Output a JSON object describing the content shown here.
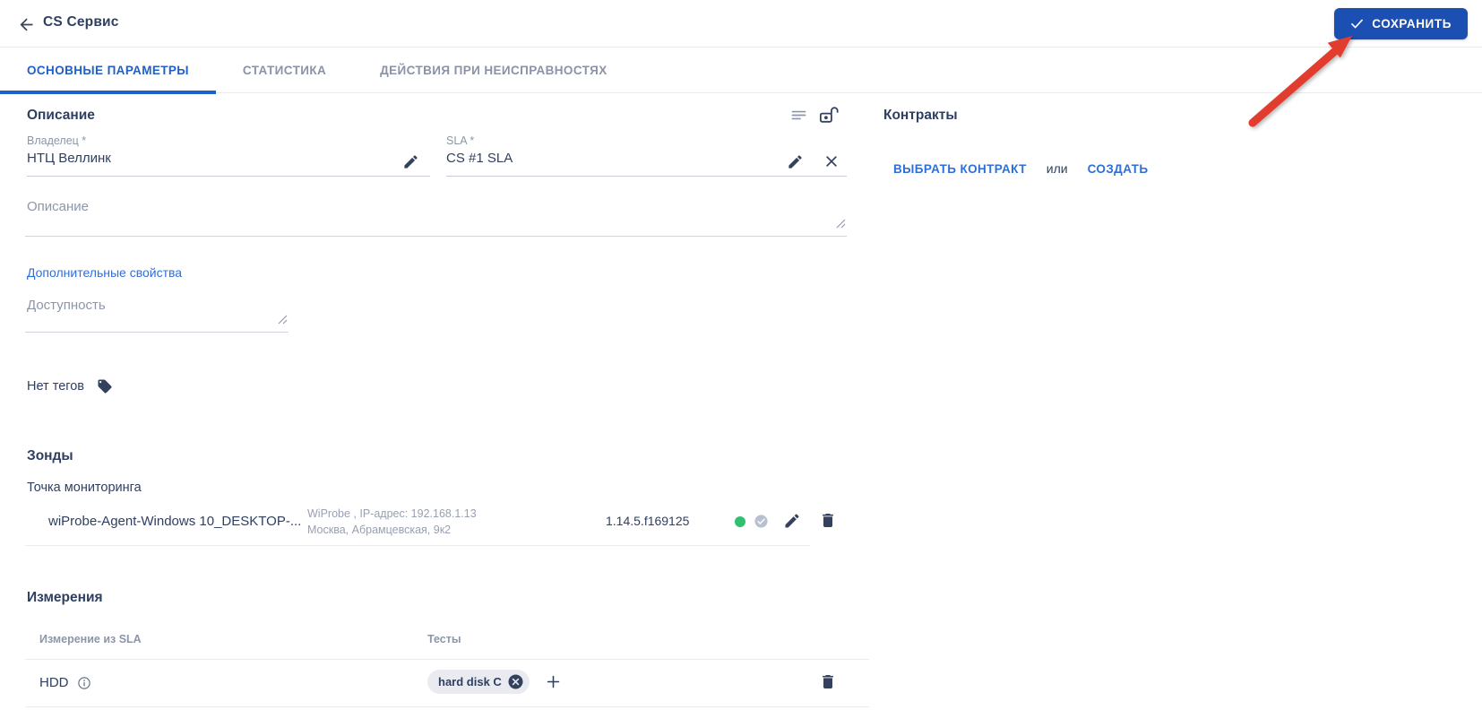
{
  "header": {
    "title": "CS Сервис",
    "save_label": "СОХРАНИТЬ"
  },
  "tabs": [
    {
      "label": "ОСНОВНЫЕ ПАРАМЕТРЫ",
      "active": true
    },
    {
      "label": "СТАТИСТИКА",
      "active": false
    },
    {
      "label": "ДЕЙСТВИЯ ПРИ НЕИСПРАВНОСТЯХ",
      "active": false
    }
  ],
  "description": {
    "section_title": "Описание",
    "owner": {
      "label": "Владелец *",
      "value": "НТЦ Веллинк"
    },
    "sla": {
      "label": "SLA *",
      "value": "CS #1 SLA"
    },
    "notes_label": "Описание",
    "extra_props_link": "Дополнительные свойства",
    "availability_label": "Доступность",
    "no_tags_label": "Нет тегов"
  },
  "probes": {
    "section_title": "Зонды",
    "subtitle": "Точка мониторинга",
    "row": {
      "name": "wiProbe-Agent-Windows 10_DESKTOP-...",
      "info_line1": "WiProbe , IP-адрес: 192.168.1.13",
      "info_line2": "Москва, Абрамцевская, 9к2",
      "version": "1.14.5.f169125"
    }
  },
  "measurements": {
    "section_title": "Измерения",
    "columns": [
      "Измерение из SLA",
      "Тесты"
    ],
    "rows": [
      {
        "name": "HDD",
        "tests": [
          "hard disk C"
        ]
      }
    ]
  },
  "contracts": {
    "section_title": "Контракты",
    "select_label": "ВЫБРАТЬ КОНТРАКТ",
    "or_label": "или",
    "create_label": "СОЗДАТЬ"
  },
  "colors": {
    "save_button_blue": "#1c4fb2",
    "tab_active_blue": "#1f5fc9",
    "link_blue": "#2e6fd8",
    "text_dark": "#2e3f60",
    "label_gray": "#8d96a8",
    "icon_navy": "#33415e",
    "status_green": "#31bf72",
    "badge_gray": "#b9c1d0",
    "arrow_red": "#e23c2e"
  }
}
